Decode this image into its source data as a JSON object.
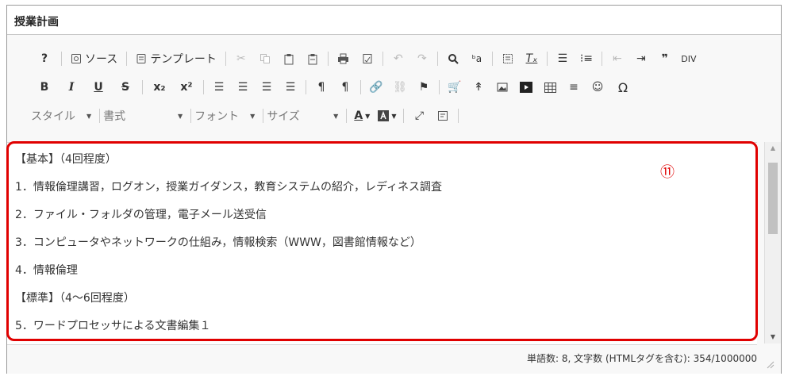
{
  "panel": {
    "title": "授業計画"
  },
  "toolbar1": {
    "help": "?",
    "source_label": "ソース",
    "template_label": "テンプレート"
  },
  "toolbar2": {
    "bold": "B",
    "italic": "I",
    "underline": "U",
    "strike": "S",
    "subscript": "x₂",
    "superscript": "x²",
    "omega": "Ω"
  },
  "toolbar3": {
    "style_label": "スタイル",
    "format_label": "書式",
    "font_label": "フォント",
    "size_label": "サイズ",
    "text_color": "A"
  },
  "content": {
    "lines": [
      "【基本】（4回程度）",
      "1．情報倫理講習，ログオン，授業ガイダンス，教育システムの紹介，レディネス調査",
      "2．ファイル・フォルダの管理，電子メール送受信",
      "3．コンピュータやネットワークの仕組み，情報検索（WWW，図書館情報など）",
      "4．情報倫理",
      "【標準】（4～6回程度）",
      "5．ワードプロセッサによる文書編集１"
    ]
  },
  "annotation": {
    "marker": "⑪",
    "color": "#e00000"
  },
  "status": {
    "text": "単語数: 8, 文字数 (HTMLタグを含む): 354/1000000"
  }
}
